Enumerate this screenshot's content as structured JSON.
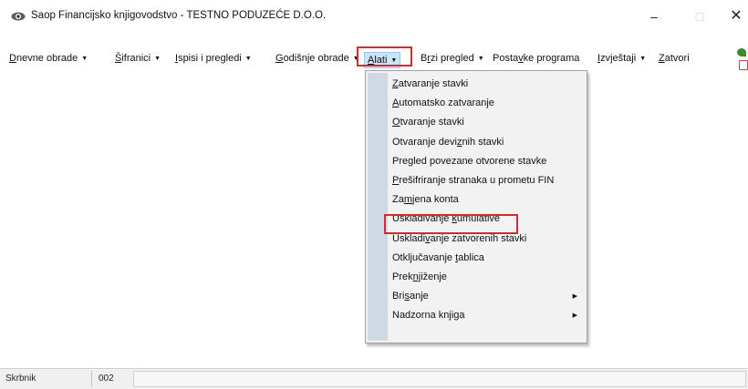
{
  "window": {
    "title": "Saop Financijsko knjigovodstvo - TESTNO PODUZEĆE D.O.O.",
    "minimize": "–",
    "maximize": "□",
    "close": "✕"
  },
  "menubar": {
    "items": [
      {
        "pre": "",
        "ul": "D",
        "post": "nevne obrade"
      },
      {
        "pre": "",
        "ul": "Š",
        "post": "ifranici"
      },
      {
        "pre": "",
        "ul": "I",
        "post": "spisi i pregledi"
      },
      {
        "pre": "",
        "ul": "G",
        "post": "odišnje obrade"
      },
      {
        "pre": "",
        "ul": "A",
        "post": "lati"
      },
      {
        "pre": "B",
        "ul": "r",
        "post": "zi pregled"
      },
      {
        "pre": "Posta",
        "ul": "v",
        "post": "ke programa"
      },
      {
        "pre": "",
        "ul": "I",
        "post": "zvještaji"
      },
      {
        "pre": "",
        "ul": "Z",
        "post": "atvori"
      }
    ],
    "arrow": "▼",
    "selected_index": 4
  },
  "dropdown": {
    "items": [
      {
        "pre": "",
        "ul": "Z",
        "post": "atvaranje stavki"
      },
      {
        "pre": "",
        "ul": "A",
        "post": "utomatsko zatvaranje"
      },
      {
        "pre": "",
        "ul": "O",
        "post": "tvaranje stavki"
      },
      {
        "pre": "Otvaranje devi",
        "ul": "z",
        "post": "nih stavki"
      },
      {
        "pre": "Pregled povezane otvorene stavke",
        "ul": "",
        "post": ""
      },
      {
        "pre": "",
        "ul": "P",
        "post": "rešifriranje stranaka u prometu FIN"
      },
      {
        "pre": "Za",
        "ul": "m",
        "post": "jena konta"
      },
      {
        "pre": "Usklađivanje ",
        "ul": "k",
        "post": "umulative"
      },
      {
        "pre": "Uskladi",
        "ul": "v",
        "post": "anje zatvorenih stavki"
      },
      {
        "pre": "Otključavanje ",
        "ul": "t",
        "post": "ablica"
      },
      {
        "pre": "Prek",
        "ul": "nj",
        "post": "iženje"
      },
      {
        "pre": "Bri",
        "ul": "s",
        "post": "anje",
        "submenu": true
      },
      {
        "pre": "Nadzorna knjiga",
        "ul": "",
        "post": "",
        "submenu": true
      }
    ],
    "submenu_arrow": "▶",
    "highlighted_index": 7
  },
  "statusbar": {
    "label": "Skrbnik",
    "value": "002"
  },
  "colors": {
    "highlight_border": "#d9272e",
    "menu_selected_bg": "#cce4f7",
    "dropdown_strip": "#cfd9e4"
  }
}
